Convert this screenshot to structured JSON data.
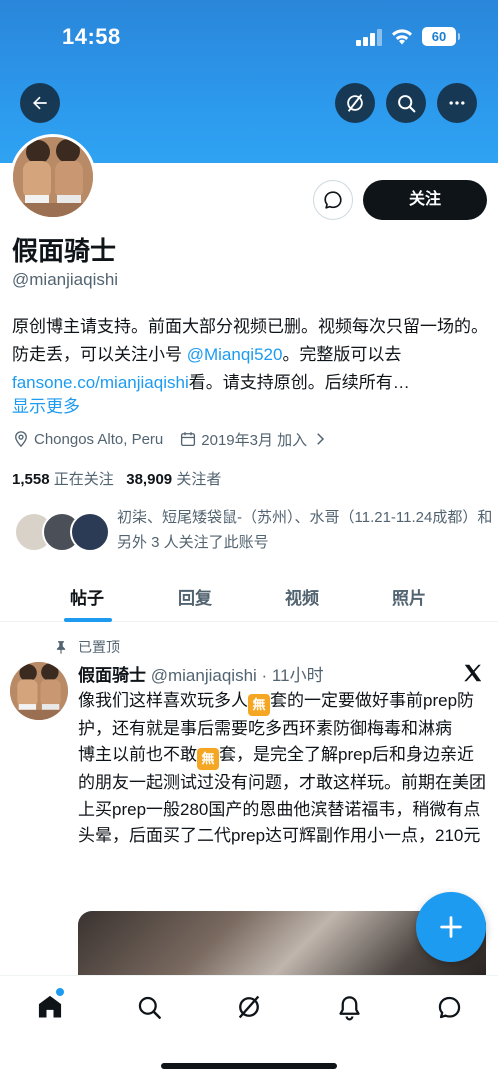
{
  "status_bar": {
    "time": "14:58",
    "battery": "60"
  },
  "colors": {
    "accent": "#1d9bf0",
    "banner": "#2c98ec",
    "text": "#0f1419",
    "muted": "#536471"
  },
  "header_icons": {
    "back": "arrow-left-icon",
    "grok": "grok-icon",
    "search": "search-icon",
    "more": "more-horizontal-icon"
  },
  "profile": {
    "display_name": "假面骑士",
    "handle": "@mianjiaqishi",
    "follow_label": "关注",
    "bio_1": "原创博主请支持。前面大部分视频已删。视频每次只留一场的。防走丢，可以关注小号 ",
    "bio_mention": "@Mianqi520",
    "bio_2": "。完整版可以去",
    "bio_link": "fansone.co/mianjiaqishi",
    "bio_3": "看。请支持原创。后续所有…",
    "show_more": "显示更多",
    "location": "Chongos Alto, Peru",
    "joined": "2019年3月 加入",
    "following_count": "1,558",
    "following_label": "正在关注",
    "followers_count": "38,909",
    "followers_label": "关注者",
    "followed_by": "初柒、短尾矮袋鼠-（苏州）、水哥（11.21-11.24成都）和另外 3 人关注了此账号"
  },
  "tabs": [
    {
      "label": "帖子",
      "active": true
    },
    {
      "label": "回复",
      "active": false
    },
    {
      "label": "视频",
      "active": false
    },
    {
      "label": "照片",
      "active": false
    }
  ],
  "post": {
    "pinned_label": "已置顶",
    "author": "假面骑士",
    "handle_time": "@mianjiaqishi · 11小时",
    "emoji": "無",
    "text_1": "像我们这样喜欢玩多人",
    "text_2": "套的一定要做好事前prep防护，还有就是事后需要吃多西环素防御梅毒和淋病",
    "text_3": "博主以前也不敢",
    "text_4": "套，是完全了解prep后和身边亲近的朋友一起测试过没有问题，才敢这样玩。前期在美团上买prep一般280国产的恩曲他滨替诺福韦，稍微有点头晕，后面买了二代prep达可辉副作用小一点，210元"
  },
  "bottom_nav": [
    "home-icon",
    "search-icon",
    "grok-icon",
    "notifications-icon",
    "messages-icon"
  ]
}
